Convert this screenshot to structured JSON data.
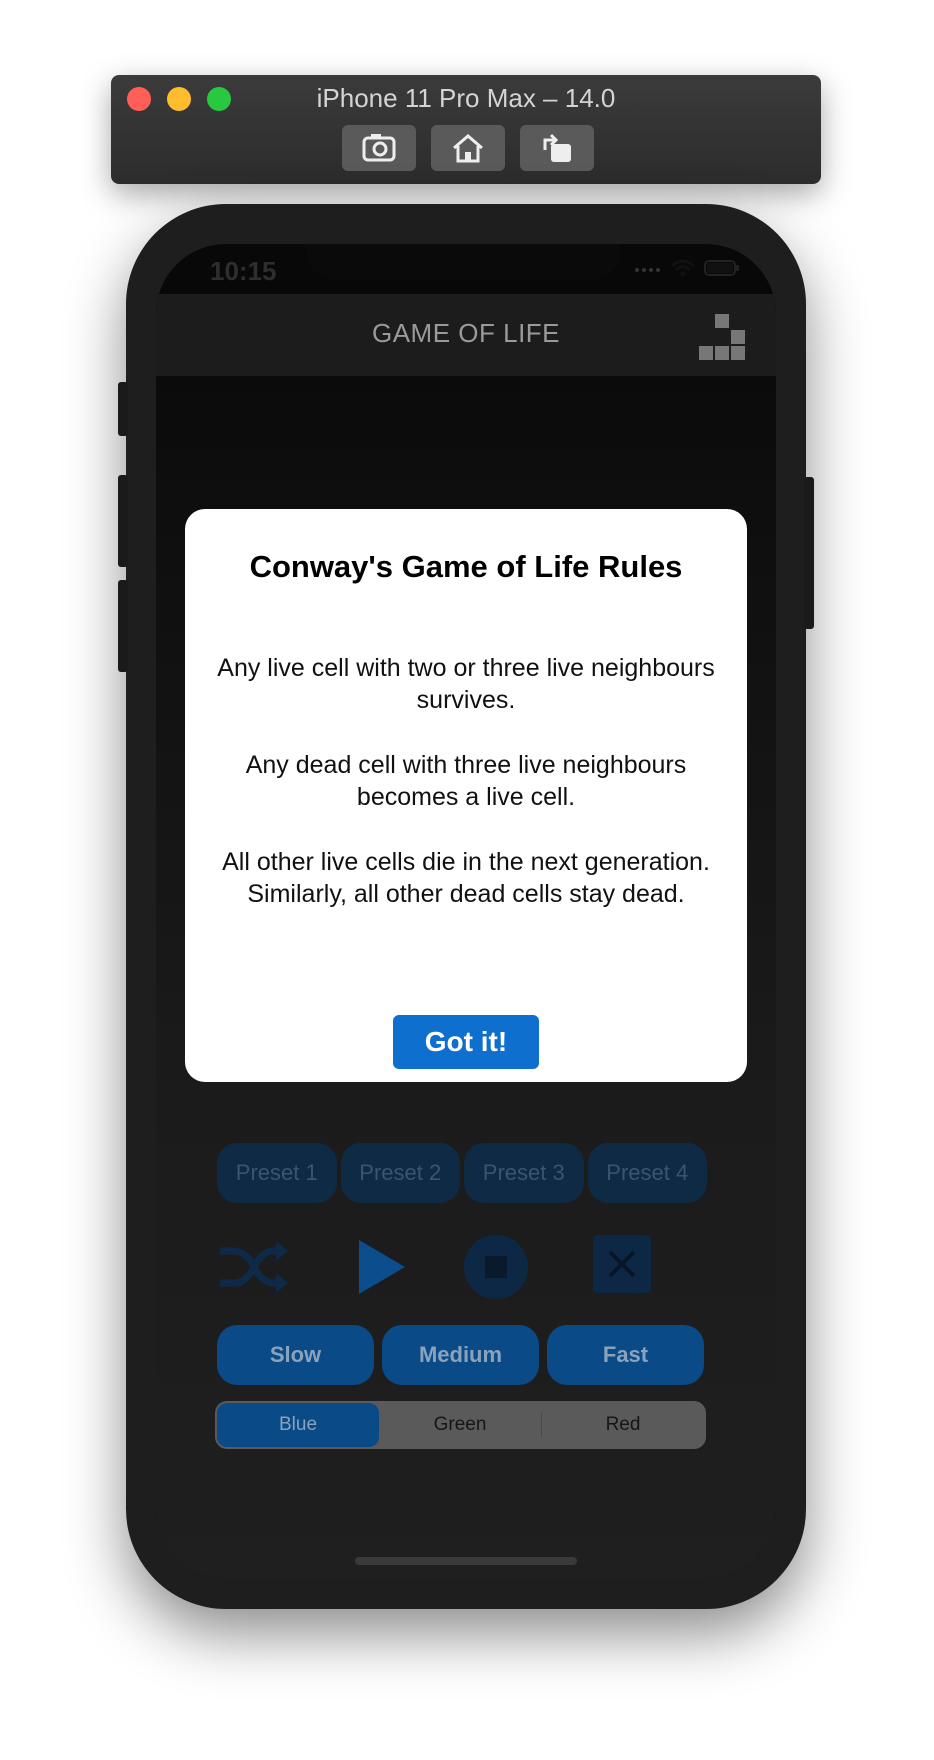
{
  "simulator": {
    "title": "iPhone 11 Pro Max – 14.0",
    "buttons": [
      "screenshot-icon",
      "home-icon",
      "rotate-icon"
    ]
  },
  "status_bar": {
    "time": "10:15"
  },
  "nav": {
    "title": "GAME OF LIFE",
    "right_icon": "grid-icon"
  },
  "controls": {
    "presets": [
      "Preset 1",
      "Preset 2",
      "Preset 3",
      "Preset 4"
    ],
    "icons": [
      "shuffle-icon",
      "play-icon",
      "stop-icon",
      "clear-icon"
    ],
    "speeds": [
      "Slow",
      "Medium",
      "Fast"
    ],
    "colors": {
      "options": [
        "Blue",
        "Green",
        "Red"
      ],
      "selected": "Blue"
    }
  },
  "modal": {
    "title": "Conway's Game of Life Rules",
    "rules": [
      "Any live cell with two or three live neighbours survives.",
      "Any dead cell with three live neighbours becomes a live cell.",
      "All other live cells die in the next generation. Similarly, all other dead cells stay dead."
    ],
    "button": "Got it!"
  },
  "accent_colors": {
    "button_blue": "#0f6fcf",
    "dim_blue": "#0a4a86"
  }
}
